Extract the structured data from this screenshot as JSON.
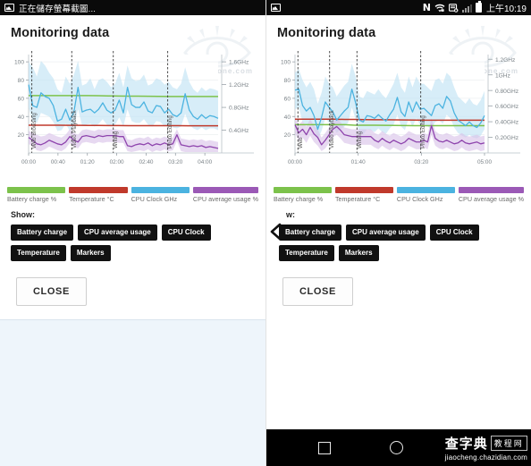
{
  "left_panel": {
    "statusbar": {
      "screenshot_text": "正在儲存螢幕截圖...",
      "icon_screenshot": "image-icon"
    },
    "header": {
      "title": "Monitoring data",
      "watermark": "vr-zone.com"
    },
    "legend": [
      {
        "label": "Battery charge %",
        "color": "#7cc24b"
      },
      {
        "label": "Temperature °C",
        "color": "#c0392b"
      },
      {
        "label": "CPU Clock GHz",
        "color": "#4bb3e0"
      },
      {
        "label": "CPU average usage %",
        "color": "#9b59b6"
      }
    ],
    "show_label": "Show:",
    "toggle_buttons": [
      "Battery charge",
      "CPU average usage",
      "CPU Clock",
      "Temperature",
      "Markers"
    ],
    "close_label": "CLOSE"
  },
  "right_panel": {
    "statusbar": {
      "icon_screenshot": "image-icon",
      "icons": [
        "nfc-icon",
        "wifi-lock-icon",
        "sync-error-icon",
        "signal-icon",
        "battery-icon"
      ],
      "clock": "上午10:19"
    },
    "header": {
      "title": "Monitoring data",
      "watermark": "vr-zone.com"
    },
    "legend": [
      {
        "label": "Battery charge %",
        "color": "#7cc24b"
      },
      {
        "label": "Temperature °C",
        "color": "#c0392b"
      },
      {
        "label": "CPU Clock GHz",
        "color": "#4bb3e0"
      },
      {
        "label": "CPU average usage %",
        "color": "#9b59b6"
      }
    ],
    "show_label": "w:",
    "toggle_buttons": [
      "Battery charge",
      "CPU average usage",
      "CPU Clock",
      "Temperature",
      "Markers"
    ],
    "close_label": "CLOSE",
    "navbar": {
      "recents": "square-icon",
      "home": "circle-icon",
      "watermark_cn": "查字典",
      "watermark_cn2": "教程网",
      "watermark_url": "jiaocheng.chazidian.com"
    }
  },
  "chart_data": [
    {
      "id": "left",
      "type": "line",
      "title": "Monitoring data",
      "xlabel": "",
      "ylabel": "",
      "grid": true,
      "legend_position": "bottom",
      "xtick_labels": [
        "00:00",
        "00:40",
        "01:20",
        "02:00",
        "02:40",
        "03:20",
        "04:00"
      ],
      "xlim_minutes": [
        0,
        4.7
      ],
      "y_left_ticks": [
        20,
        40,
        60,
        80,
        100
      ],
      "ylim_left": [
        0,
        108
      ],
      "y_right_ticks": [
        "0.4GHz",
        "0.8GHz",
        "1.2GHz",
        "1.6GHz"
      ],
      "ylim_right_ghz": [
        0,
        1.73
      ],
      "markers": [
        {
          "label": "Web Browsing",
          "x_minutes": 0.08
        },
        {
          "label": "Video Playback",
          "x_minutes": 1.07
        },
        {
          "label": "Writing",
          "x_minutes": 2.1
        },
        {
          "label": "Photo Editing",
          "x_minutes": 3.45
        }
      ],
      "series": [
        {
          "name": "Battery charge %",
          "color": "#7cc24b",
          "values": [
            63,
            63,
            63,
            63,
            63,
            63,
            63,
            62.8,
            62.6,
            62.5,
            62.4,
            62.3,
            62.2,
            62.1,
            62,
            62,
            62,
            62,
            62,
            62
          ]
        },
        {
          "name": "Temperature °C",
          "color": "#c0392b",
          "values": [
            30.5,
            30.5,
            30.4,
            30.4,
            30.3,
            30.3,
            30.2,
            30.2,
            30.1,
            30.1,
            30,
            30,
            30,
            30,
            29.9,
            29.9,
            29.8,
            29.8,
            29.8,
            29.8
          ]
        },
        {
          "name": "CPU Clock GHz",
          "color": "#4bb3e0",
          "band_color": "#bfe2f4",
          "values": [
            75,
            52,
            50,
            66,
            62,
            60,
            52,
            35,
            37,
            48,
            36,
            45,
            72,
            45,
            47,
            48,
            44,
            48,
            55,
            47,
            44,
            47,
            58,
            44,
            72,
            53,
            50,
            50,
            56,
            46,
            44,
            52,
            51,
            44,
            48,
            42,
            40,
            44,
            65,
            47,
            40,
            37,
            42,
            38,
            41,
            40,
            38
          ],
          "band_hi": [
            100,
            94,
            84,
            101,
            96,
            88,
            82,
            70,
            66,
            84,
            76,
            86,
            101,
            74,
            76,
            82,
            70,
            80,
            82,
            78,
            72,
            76,
            88,
            72,
            96,
            82,
            79,
            80,
            86,
            74,
            76,
            82,
            80,
            75,
            78,
            72,
            70,
            76,
            94,
            78,
            70,
            66,
            72,
            68,
            71,
            70,
            68
          ],
          "band_lo": [
            50,
            35,
            33,
            44,
            42,
            40,
            34,
            24,
            25,
            32,
            24,
            30,
            48,
            30,
            31,
            32,
            29,
            32,
            37,
            31,
            29,
            31,
            39,
            29,
            48,
            35,
            33,
            33,
            37,
            31,
            29,
            35,
            34,
            29,
            32,
            28,
            27,
            29,
            43,
            31,
            27,
            25,
            28,
            25,
            27,
            27,
            25
          ]
        },
        {
          "name": "CPU average usage %",
          "color": "#8e44ad",
          "band_color": "#d9c2e8",
          "values": [
            17,
            14,
            10,
            9,
            11,
            14,
            12,
            10,
            9,
            12,
            18,
            14,
            12,
            18,
            19,
            18,
            17,
            19,
            18,
            19,
            19,
            19,
            18,
            18,
            8,
            7,
            9,
            10,
            9,
            11,
            8,
            10,
            9,
            11,
            9,
            10,
            20,
            9,
            8,
            7,
            8,
            7,
            8,
            6,
            7,
            6,
            5
          ],
          "band_hi": [
            24,
            22,
            20,
            18,
            19,
            22,
            20,
            18,
            17,
            20,
            26,
            22,
            20,
            25,
            26,
            25,
            24,
            26,
            25,
            26,
            26,
            26,
            25,
            25,
            15,
            14,
            16,
            17,
            16,
            18,
            15,
            17,
            16,
            18,
            16,
            17,
            26,
            16,
            15,
            14,
            15,
            14,
            15,
            13,
            14,
            13,
            12
          ],
          "band_lo": [
            10,
            7,
            3,
            2,
            4,
            7,
            5,
            3,
            2,
            5,
            11,
            7,
            5,
            11,
            12,
            11,
            10,
            12,
            11,
            12,
            12,
            12,
            11,
            11,
            2,
            1,
            2,
            3,
            2,
            4,
            1,
            3,
            2,
            4,
            2,
            3,
            13,
            2,
            1,
            1,
            1,
            1,
            1,
            1,
            1,
            1,
            1
          ]
        }
      ]
    },
    {
      "id": "right",
      "type": "line",
      "title": "Monitoring data",
      "xlabel": "",
      "ylabel": "",
      "grid": true,
      "legend_position": "bottom",
      "xtick_labels": [
        "00:00",
        "01:40",
        "03:20",
        "05:00"
      ],
      "xlim_minutes": [
        0,
        5.2
      ],
      "y_left_ticks": [
        20,
        40,
        60,
        80,
        100
      ],
      "ylim_left": [
        0,
        108
      ],
      "y_right_ticks": [
        "0.20GHz",
        "0.40GHz",
        "0.60GHz",
        "0.80GHz",
        "1GHz",
        "1.2GHz"
      ],
      "ylim_right_ghz": [
        0,
        1.3
      ],
      "markers": [
        {
          "label": "Web",
          "x_minutes": 0.08
        },
        {
          "label": "Video Playback",
          "x_minutes": 0.95
        },
        {
          "label": "Writing",
          "x_minutes": 1.7
        },
        {
          "label": "Photo Editing",
          "x_minutes": 3.45
        }
      ],
      "series": [
        {
          "name": "Battery charge %",
          "color": "#7cc24b",
          "values": [
            31,
            31,
            31,
            31,
            31,
            31,
            30.5,
            30.5,
            30.5,
            30.3,
            30.2,
            30.1,
            30,
            30,
            30,
            30,
            30,
            30,
            30,
            30
          ]
        },
        {
          "name": "Temperature °C",
          "color": "#c0392b",
          "values": [
            37,
            37,
            37,
            37,
            37,
            36.8,
            36.8,
            36.6,
            36.5,
            36.4,
            36.3,
            36.2,
            36.1,
            36,
            36,
            36,
            36,
            36,
            36,
            36
          ]
        },
        {
          "name": "CPU Clock GHz",
          "color": "#4bb3e0",
          "band_color": "#bfe2f4",
          "values": [
            69,
            70,
            52,
            46,
            50,
            41,
            26,
            39,
            56,
            50,
            45,
            36,
            41,
            46,
            50,
            70,
            55,
            36,
            34,
            41,
            40,
            38,
            42,
            38,
            35,
            42,
            48,
            61,
            45,
            40,
            56,
            45,
            56,
            48,
            49,
            45,
            41,
            52,
            54,
            49,
            62,
            57,
            44,
            36,
            33,
            30,
            34,
            30,
            28,
            33,
            41
          ],
          "band_hi": [
            88,
            92,
            80,
            72,
            78,
            70,
            54,
            66,
            84,
            76,
            72,
            62,
            68,
            74,
            78,
            98,
            84,
            62,
            60,
            68,
            66,
            64,
            70,
            64,
            60,
            68,
            76,
            88,
            72,
            66,
            84,
            72,
            84,
            76,
            76,
            72,
            68,
            80,
            82,
            76,
            88,
            84,
            72,
            62,
            58,
            54,
            60,
            54,
            52,
            58,
            68
          ],
          "band_lo": [
            48,
            50,
            34,
            30,
            33,
            26,
            15,
            24,
            38,
            33,
            29,
            22,
            26,
            29,
            33,
            50,
            37,
            22,
            20,
            26,
            25,
            23,
            27,
            23,
            21,
            27,
            31,
            42,
            29,
            25,
            38,
            29,
            38,
            31,
            32,
            29,
            26,
            34,
            36,
            32,
            42,
            38,
            28,
            22,
            19,
            17,
            20,
            17,
            16,
            19,
            26
          ]
        },
        {
          "name": "CPU average usage %",
          "color": "#8e44ad",
          "band_color": "#d9c2e8",
          "values": [
            31,
            22,
            26,
            20,
            28,
            21,
            17,
            9,
            14,
            20,
            26,
            29,
            25,
            20,
            19,
            18,
            18,
            18,
            18,
            18,
            18,
            14,
            12,
            16,
            13,
            11,
            14,
            12,
            10,
            12,
            16,
            14,
            12,
            12,
            14,
            12,
            30,
            16,
            13,
            12,
            14,
            12,
            10,
            11,
            14,
            11,
            10,
            11,
            12,
            10,
            11
          ],
          "band_hi": [
            40,
            31,
            35,
            29,
            37,
            30,
            26,
            17,
            22,
            28,
            35,
            38,
            34,
            28,
            27,
            26,
            26,
            26,
            26,
            26,
            26,
            22,
            20,
            24,
            21,
            19,
            22,
            20,
            18,
            20,
            24,
            22,
            20,
            20,
            22,
            20,
            38,
            24,
            21,
            20,
            22,
            20,
            18,
            19,
            22,
            19,
            18,
            19,
            20,
            18,
            19
          ],
          "band_lo": [
            22,
            13,
            17,
            11,
            19,
            12,
            8,
            2,
            5,
            11,
            17,
            20,
            16,
            11,
            10,
            9,
            9,
            9,
            9,
            9,
            9,
            6,
            4,
            8,
            5,
            3,
            6,
            4,
            2,
            4,
            8,
            6,
            4,
            4,
            6,
            4,
            20,
            8,
            5,
            4,
            6,
            4,
            2,
            3,
            6,
            3,
            2,
            3,
            4,
            2,
            3
          ]
        }
      ]
    }
  ]
}
